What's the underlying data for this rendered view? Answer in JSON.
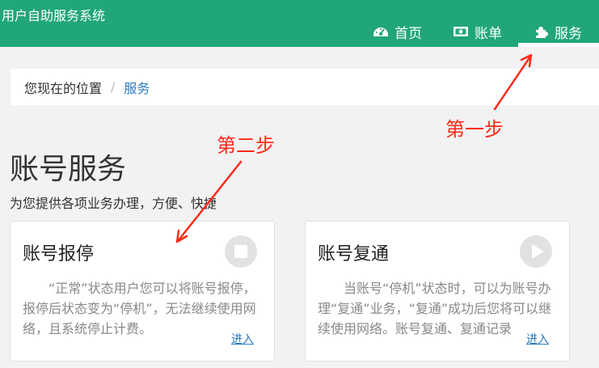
{
  "header": {
    "app_title": "用户自助服务系统",
    "nav": [
      {
        "label": "首页",
        "icon": "dashboard-icon"
      },
      {
        "label": "账单",
        "icon": "money-bill-icon"
      },
      {
        "label": "服务",
        "icon": "puzzle-piece-icon",
        "active": true
      }
    ]
  },
  "breadcrumb": {
    "home": "您现在的位置",
    "separator": "/",
    "current": "服务"
  },
  "page": {
    "title": "账号服务",
    "subtitle": "为您提供各项业务办理，方便、快捷"
  },
  "cards": [
    {
      "title": "账号报停",
      "icon": "stop-circle-icon",
      "description": "“正常”状态用户您可以将账号报停，报停后状态变为“停机”，无法继续使用网络，且系统停止计费。",
      "link": "进入"
    },
    {
      "title": "账号复通",
      "icon": "play-circle-icon",
      "description": "当账号“停机”状态时，可以为账号办理“复通”业务，“复通”成功后您将可以继续使用网络。账号复通、复通记录",
      "link": "进入"
    }
  ],
  "annotations": {
    "step1": "第一步",
    "step2": "第二步",
    "color": "#ff2a1a"
  },
  "colors": {
    "header_bg": "#21a67a",
    "link": "#2a7bc0"
  }
}
